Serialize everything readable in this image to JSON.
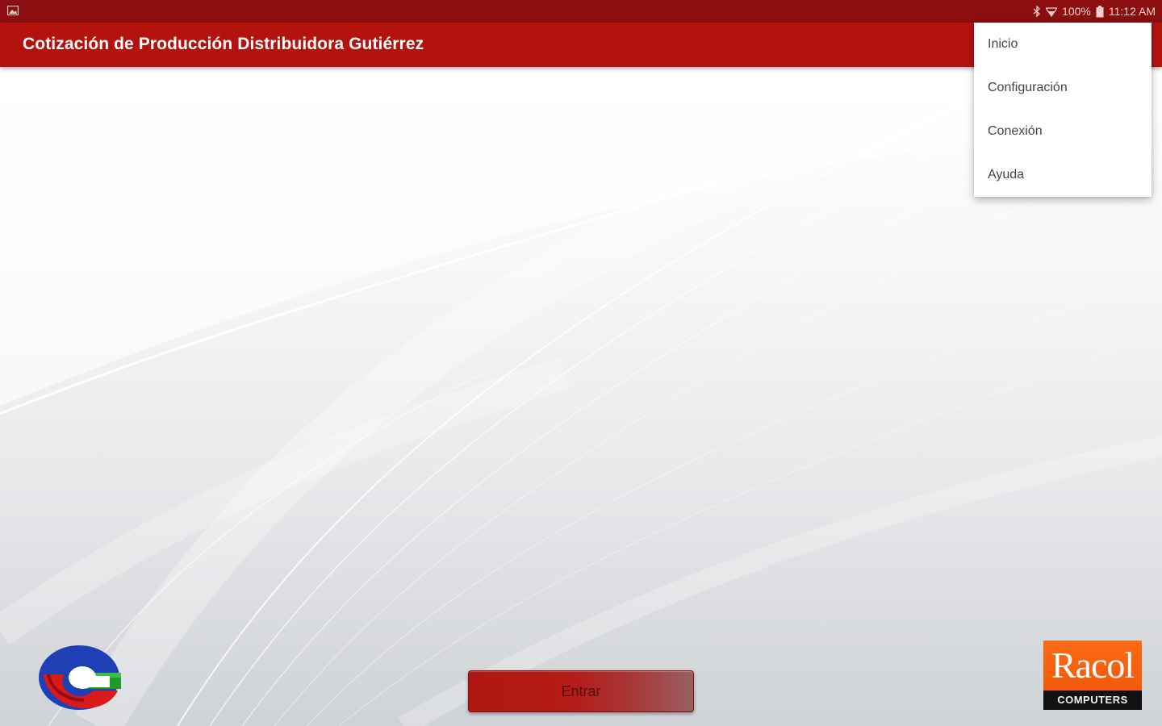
{
  "status_bar": {
    "battery": "100%",
    "time": "11:12 AM",
    "icons": [
      "image-icon",
      "bluetooth-icon",
      "wifi-icon",
      "battery-icon"
    ]
  },
  "app_bar": {
    "title": "Cotización de Producción Distribuidora Gutiérrez"
  },
  "overflow_menu": {
    "items": [
      {
        "label": "Inicio"
      },
      {
        "label": "Configuración"
      },
      {
        "label": "Conexión"
      },
      {
        "label": "Ayuda"
      }
    ]
  },
  "main": {
    "enter_button_label": "Entrar"
  },
  "branding": {
    "racol_name": "Racol",
    "racol_subtitle": "COMPUTERS",
    "left_logo": "cg-logo"
  },
  "colors": {
    "status_bar": "#8c0e0e",
    "app_bar": "#b3120f",
    "button": "#b01712",
    "racol_orange": "#f05a0a"
  }
}
